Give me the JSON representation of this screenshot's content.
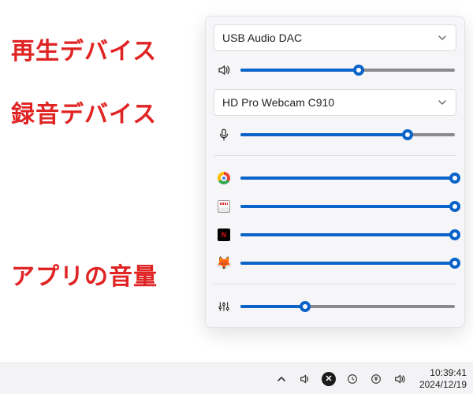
{
  "annotations": {
    "playback_label": "再生デバイス",
    "record_label": "録音デバイス",
    "app_volume_label": "アプリの音量"
  },
  "playback": {
    "device_name": "USB Audio DAC",
    "volume_percent": 55
  },
  "recording": {
    "device_name": "HD Pro Webcam C910",
    "volume_percent": 78
  },
  "apps": [
    {
      "icon": "chrome",
      "name": "Google Chrome",
      "volume_percent": 100
    },
    {
      "icon": "mpc",
      "name": "Media Player Classic",
      "volume_percent": 100
    },
    {
      "icon": "netflix",
      "name": "Netflix",
      "volume_percent": 100
    },
    {
      "icon": "waterfox",
      "name": "Waterfox",
      "volume_percent": 100
    }
  ],
  "mixer": {
    "volume_percent": 30
  },
  "taskbar": {
    "time": "10:39:41",
    "date": "2024/12/19"
  },
  "colors": {
    "accent": "#0a63c9",
    "label_red": "#e02424"
  }
}
